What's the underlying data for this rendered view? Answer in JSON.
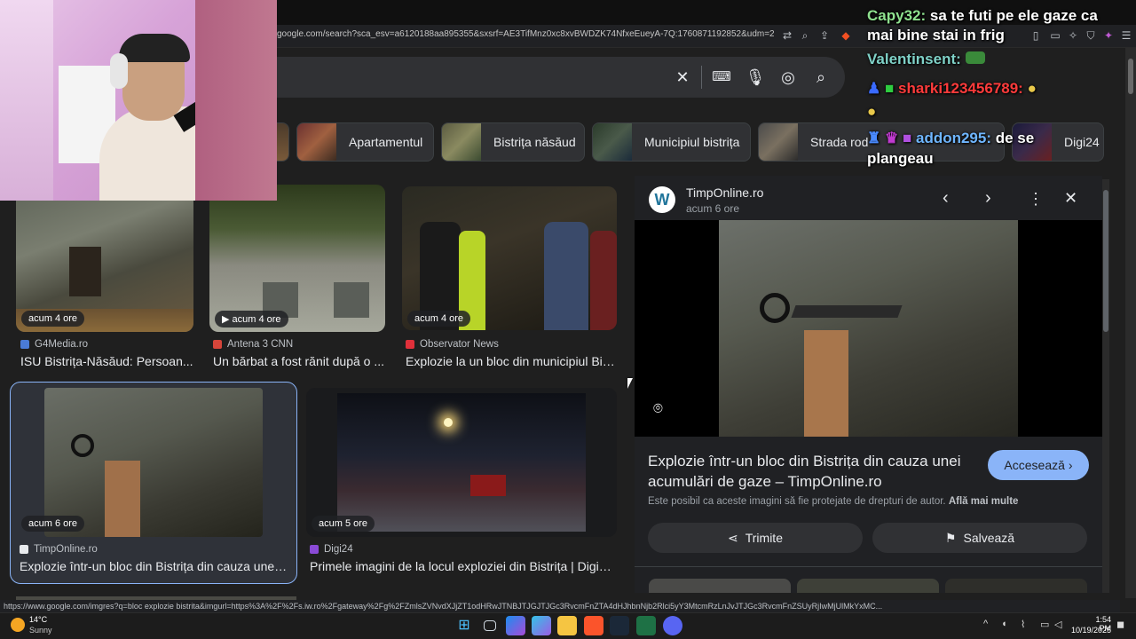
{
  "browser": {
    "url": "google.com/search?sca_esv=a6120188aa895355&sxsrf=AE3TifMnz0xc8xvBWDZK74NfxeEueyA-7Q:1760871192852&udm=2&fbs=AIIjpHx..."
  },
  "chips": [
    {
      "label": "Apartamentul"
    },
    {
      "label": "Bistrița năsăud"
    },
    {
      "label": "Municipiul bistrița"
    },
    {
      "label": "Strada rod"
    },
    {
      "label": "Digi24"
    }
  ],
  "results": [
    {
      "time": "acum 4 ore",
      "source": "G4Media.ro",
      "title": "ISU Bistrița-Năsăud: Persoan..."
    },
    {
      "time": "acum 4 ore",
      "source": "Antena 3 CNN",
      "title": "Un bărbat a fost rănit după o ..."
    },
    {
      "time": "acum 4 ore",
      "source": "Observator News",
      "title": "Explozie la un bloc din municipiul Bis..."
    },
    {
      "time": "acum 6 ore",
      "source": "TimpOnline.ro",
      "title": "Explozie într-un bloc din Bistrița din cauza unei ..."
    },
    {
      "time": "acum 5 ore",
      "source": "Digi24",
      "title": "Primele imagini de la locul exploziei din Bistrița | Digi24"
    }
  ],
  "panel": {
    "site": "TimpOnline.ro",
    "time": "acum 6 ore",
    "title": "Explozie într-un bloc din Bistrița din cauza unei acumulări de gaze – TimpOnline.ro",
    "visit_label": "Accesează",
    "copyright": "Este posibil ca aceste imagini să fie protejate de drepturi de autor.",
    "learn_more": "Află mai multe",
    "share_label": "Trimite",
    "save_label": "Salvează"
  },
  "chat": [
    {
      "user": "Capy32:",
      "text": "sa te futi pe ele gaze ca"
    },
    {
      "user": "",
      "text": "mai bine stai in frig"
    },
    {
      "user": "Valentinsent:",
      "text": ""
    },
    {
      "user": "sharki123456789:",
      "text": ""
    },
    {
      "user": "addon295:",
      "text": "de se"
    },
    {
      "user": "",
      "text": "plangeau"
    }
  ],
  "status_url": "https://www.google.com/imgres?q=bloc explozie bistrita&imgurl=https%3A%2F%2Fs.iw.ro%2Fgateway%2Fg%2FZmlsZVNvdXJjZT1odHRwJTNBJTJGJTJGc3RvcmFnZTA4dHJhbnNjb2Rlci5yY3MtcmRzLnJvJTJGc3RvcmFnZSUyRjIwMjUlMkYxMC...",
  "weather": {
    "temp": "14°C",
    "condition": "Sunny"
  },
  "clock": {
    "time": "1:54 PM",
    "date": "10/19/2025"
  },
  "colors": {
    "accent": "#8ab4f8",
    "visit_button": "#8ab4f8",
    "chat_green": "#8fe28f",
    "chat_red": "#ff3b3b",
    "chat_blue": "#6fb6ff"
  }
}
